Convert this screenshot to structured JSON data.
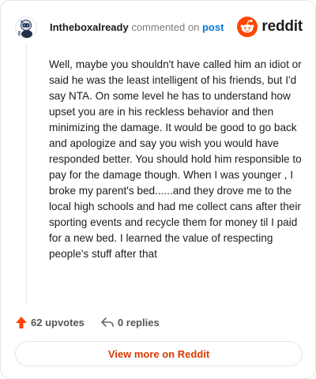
{
  "comment": {
    "username": "Intheboxalready",
    "commented_on_text": "commented on",
    "post_link_text": "post",
    "body": "Well, maybe you shouldn't have called him an idiot or said he was the least intelligent of his friends, but I'd say NTA. On some level he has to understand how upset you are in his reckless behavior and then minimizing the damage. It would be good to go back and apologize and say you wish you would have responded better. You should hold him responsible to pay for the damage though. When I was younger , I broke my parent's bed......and they drove me to the local high schools and had me collect cans after their sporting events and recycle them for money til I paid for a new bed. I learned the value of respecting people's stuff after that"
  },
  "brand": {
    "logo_text": "reddit",
    "accent_color": "#ff4500"
  },
  "actions": {
    "upvotes_label": "62 upvotes",
    "replies_label": "0 replies",
    "upvote_icon": "upvote-arrow-icon",
    "reply_icon": "reply-arrow-icon"
  },
  "footer": {
    "view_more_label": "View more on Reddit",
    "link_color": "#d93a00"
  }
}
